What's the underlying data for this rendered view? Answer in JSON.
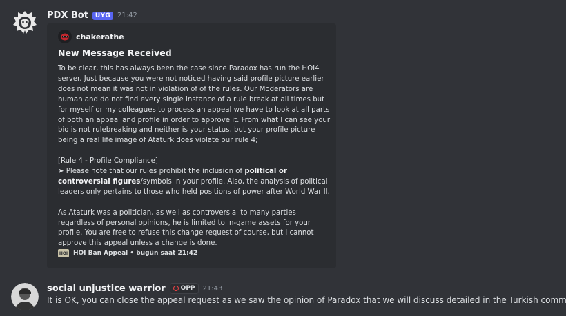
{
  "message1": {
    "username": "PDX Bot",
    "badge": "UYG",
    "time": "21:42",
    "avatar_icon": "lion-logo",
    "embed": {
      "author": "chakerathe",
      "title": "New Message Received",
      "paragraphs": [
        "To be clear, this has always been the case since Paradox has run the HOI4 server. Just because you were not noticed having said profile picture earlier does not mean it was not in violation of of the rules. Our Moderators are human and do not find every single instance of a rule break at all times but for myself or my colleagues to process an appeal we have to look at all parts of both an appeal and profile in order to approve it. From what I can see your bio is not rulebreaking and neither is your status, but your profile picture being a real life image of Ataturk does violate our rule 4;",
        "[Rule 4 - Profile Compliance]",
        "As Ataturk was a politician, as well as controversial to many parties regardless of personal opinions, he is limited to in-game assets for your profile. You are free to refuse this change request of course, but I cannot approve this appeal unless a change is done."
      ],
      "rule_pre": "➤ Please note that our rules prohibit the inclusion of ",
      "rule_bold": "political or controversial figures",
      "rule_post": "/symbols in your profile. Also, the analysis of political leaders only pertains to those who held positions of power after World War II.",
      "footer_icon_text": "HOI",
      "footer": "HOI Ban Appeal • bugün saat 21:42"
    }
  },
  "message2": {
    "username": "social unjustice warrior",
    "badge": "OPP",
    "time": "21:43",
    "text": "It is OK, you can close the appeal request as we saw the opinion of Paradox that we will discuss detailed in the Turkish community."
  }
}
